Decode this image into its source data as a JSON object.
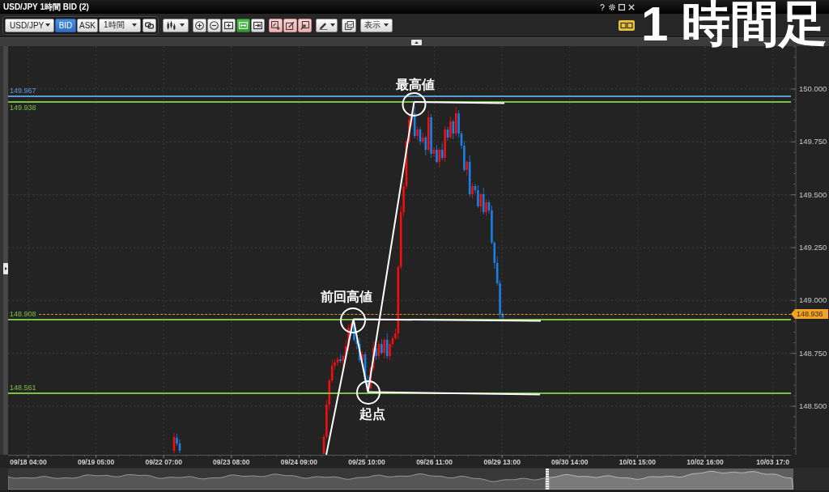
{
  "window": {
    "title": "USD/JPY 1時間 BID (2)"
  },
  "caption": "1 時間足",
  "toolbar": {
    "symbol": "USD/JPY",
    "price_type": [
      {
        "label": "BID",
        "selected": true
      },
      {
        "label": "ASK",
        "selected": false
      }
    ],
    "timeframe": "1時間",
    "view_buttons": [
      {
        "kind": "zoomin",
        "on": false
      },
      {
        "kind": "zoomout",
        "on": false
      },
      {
        "kind": "expand",
        "on": false
      },
      {
        "kind": "fit",
        "on": true
      },
      {
        "kind": "end",
        "on": false
      }
    ],
    "view_menu": "表示"
  },
  "chart": {
    "price_ticks": [
      "150.000",
      "149.750",
      "149.500",
      "149.250",
      "149.000",
      "148.750",
      "148.500"
    ],
    "time_ticks": [
      "09/18 04:00",
      "09/19 05:00",
      "09/22 07:00",
      "09/23 08:00",
      "09/24 09:00",
      "09/25 10:00",
      "09/26 11:00",
      "09/29 13:00",
      "09/30 14:00",
      "10/01 15:00",
      "10/02 16:00",
      "10/03 17:0"
    ],
    "levels": [
      {
        "label": "149.967",
        "color": "#5b9bd5"
      },
      {
        "label": "149.938",
        "color": "#7ac143"
      },
      {
        "label": "148.908",
        "color": "#7ac143"
      },
      {
        "label": "148.561",
        "color": "#7ac143"
      }
    ],
    "current_price": "148.936",
    "annotations": [
      {
        "label": "最高値"
      },
      {
        "label": "前回高値"
      },
      {
        "label": "起点"
      }
    ]
  }
}
